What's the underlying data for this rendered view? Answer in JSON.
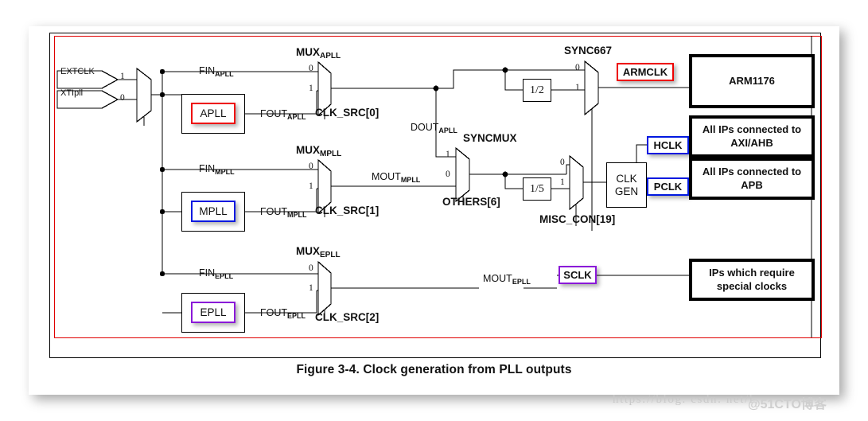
{
  "figure": {
    "caption": "Figure 3-4. Clock generation from PLL outputs"
  },
  "watermark": {
    "url": "https://blog. csdn. net/l",
    "tag": "@51CTO博客"
  },
  "inputs": [
    {
      "name": "EXTCLK",
      "mux_select_value": "1"
    },
    {
      "name": "XTIpll",
      "mux_select_value": "0"
    }
  ],
  "pll_rows": [
    {
      "pll_name": "APLL",
      "pll_color": "#ee0000",
      "fin_label": "FIN",
      "fin_sub": "APLL",
      "fout_label": "FOUT",
      "fout_sub": "APLL",
      "mux_name": "MUX",
      "mux_sub": "APLL",
      "mux_in0": "0",
      "mux_in1": "1",
      "select_signal": "CLK_SRC[0]"
    },
    {
      "pll_name": "MPLL",
      "pll_color": "#0018e0",
      "fin_label": "FIN",
      "fin_sub": "MPLL",
      "fout_label": "FOUT",
      "fout_sub": "MPLL",
      "mux_name": "MUX",
      "mux_sub": "MPLL",
      "mux_in0": "0",
      "mux_in1": "1",
      "select_signal": "CLK_SRC[1]"
    },
    {
      "pll_name": "EPLL",
      "pll_color": "#8a18d8",
      "fin_label": "FIN",
      "fin_sub": "EPLL",
      "fout_label": "FOUT",
      "fout_sub": "EPLL",
      "mux_name": "MUX",
      "mux_sub": "EPLL",
      "mux_in0": "0",
      "mux_in1": "1",
      "select_signal": "CLK_SRC[2]"
    }
  ],
  "nets": {
    "dout_apll": "DOUT",
    "dout_apll_sub": "APLL",
    "mout_mpll": "MOUT",
    "mout_mpll_sub": "MPLL",
    "mout_epll": "MOUT",
    "mout_epll_sub": "EPLL"
  },
  "muxes": {
    "syncmux": {
      "name": "SYNCMUX",
      "in1": "1",
      "in0": "0",
      "select_signal": "OTHERS[6]"
    },
    "sync667": {
      "name": "SYNC667",
      "in0": "0",
      "in1": "1"
    },
    "misc": {
      "in0": "0",
      "in1": "1",
      "select_signal": "MISC_CON[19]"
    }
  },
  "dividers": [
    {
      "label": "1/2"
    },
    {
      "label": "1/5"
    }
  ],
  "clkgen": {
    "line1": "CLK",
    "line2": "GEN"
  },
  "clock_chips": [
    {
      "label": "ARMCLK",
      "color": "red"
    },
    {
      "label": "HCLK",
      "color": "blue"
    },
    {
      "label": "PCLK",
      "color": "blue"
    },
    {
      "label": "SCLK",
      "color": "purple"
    }
  ],
  "ip_blocks": [
    {
      "line1": "ARM1176",
      "line2": ""
    },
    {
      "line1": "All IPs connected to",
      "line2": "AXI/AHB"
    },
    {
      "line1": "All IPs connected to",
      "line2": "APB"
    },
    {
      "line1": "IPs which require",
      "line2": "special clocks"
    }
  ]
}
